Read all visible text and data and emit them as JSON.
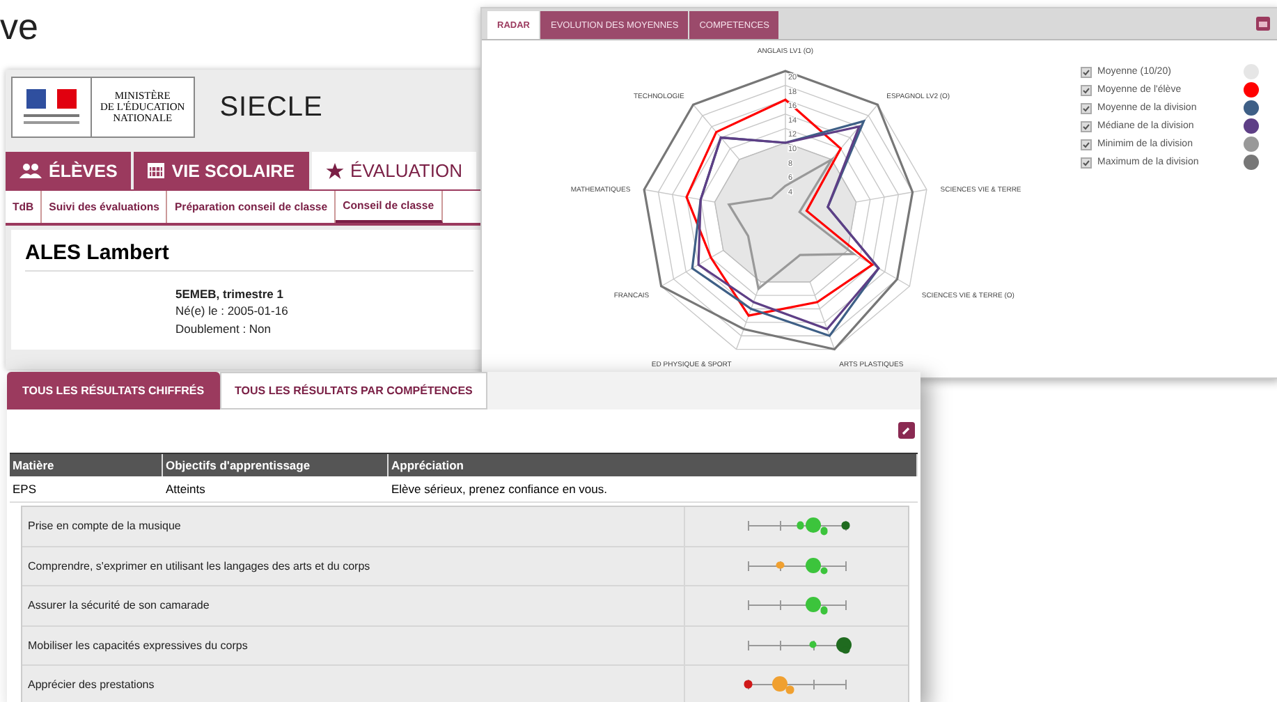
{
  "fragment": {
    "text": "ve"
  },
  "radar_window": {
    "tabs": [
      {
        "label": "RADAR",
        "selected": true
      },
      {
        "label": "EVOLUTION DES MOYENNES",
        "selected": false
      },
      {
        "label": "COMPETENCES",
        "selected": false
      }
    ],
    "axes": [
      "ANGLAIS LV1 (O)",
      "TECHNOLOGIE",
      "ESPAGNOL LV2 (O)",
      "MATHEMATIQUES",
      "SCIENCES VIE & TERRE",
      "FRANCAIS",
      "SCIENCES VIE & TERRE (O)",
      "ED PHYSIQUE & SPORT",
      "ARTS PLASTIQUES"
    ],
    "ticks": [
      "20",
      "18",
      "16",
      "14",
      "12",
      "10",
      "8",
      "6",
      "4"
    ],
    "legend": [
      {
        "label": "Moyenne (10/20)",
        "checked": true,
        "color": "#e6e6e6"
      },
      {
        "label": "Moyenne de l'élève",
        "checked": true,
        "color": "#ff0000"
      },
      {
        "label": "Moyenne de la division",
        "checked": true,
        "color": "#3e5f86"
      },
      {
        "label": "Médiane de la division",
        "checked": true,
        "color": "#5e3f86"
      },
      {
        "label": "Minimim de la division",
        "checked": true,
        "color": "#999999"
      },
      {
        "label": "Maximum de la division",
        "checked": true,
        "color": "#777777"
      }
    ]
  },
  "siecle": {
    "logo_lines": [
      "MINISTÈRE",
      "DE L'ÉDUCATION",
      "NATIONALE"
    ],
    "app_name": "SIECLE",
    "tabs": [
      {
        "label": "ÉLÈVES",
        "selected": false
      },
      {
        "label": "VIE SCOLAIRE",
        "selected": false
      },
      {
        "label": "ÉVALUATION",
        "selected": true
      }
    ],
    "subtabs": [
      {
        "label": "TdB",
        "selected": false
      },
      {
        "label": "Suivi des évaluations",
        "selected": false
      },
      {
        "label": "Préparation conseil de classe",
        "selected": false
      },
      {
        "label": "Conseil de classe",
        "selected": true
      }
    ],
    "student": {
      "name": "ALES Lambert",
      "class": "5EMEB, trimestre 1",
      "born": "Né(e) le : 2005-01-16",
      "repeat": "Doublement : Non"
    }
  },
  "results": {
    "tabs": [
      {
        "label": "TOUS LES RÉSULTATS CHIFFRÉS",
        "selected": true
      },
      {
        "label": "TOUS LES RÉSULTATS PAR COMPÉTENCES",
        "selected": false
      }
    ],
    "columns": [
      "Matière",
      "Objectifs d'apprentissage",
      "Appréciation"
    ],
    "rows": [
      {
        "cells": [
          "EPS",
          "Atteints",
          "Elève sérieux, prenez confiance en vous."
        ]
      }
    ],
    "competences": [
      {
        "label": "Prise en compte de la musique",
        "dots": [
          {
            "level": 0.54,
            "kind": "small",
            "color": "#3cc43c"
          },
          {
            "level": 0.67,
            "kind": "large",
            "color": "#3cc43c"
          },
          {
            "level": 0.78,
            "kind": "small",
            "color": "#3cc43c"
          },
          {
            "level": 1.0,
            "kind": "small",
            "color": "#1f6b1f"
          }
        ]
      },
      {
        "label": "Comprendre, s'exprimer en utilisant les langages des arts et du corps",
        "dots": [
          {
            "level": 0.33,
            "kind": "small",
            "color": "#f0a030"
          },
          {
            "level": 0.67,
            "kind": "large",
            "color": "#3cc43c"
          },
          {
            "level": 0.78,
            "kind": "small",
            "color": "#3cc43c"
          }
        ]
      },
      {
        "label": "Assurer la sécurité de son camarade",
        "dots": [
          {
            "level": 0.67,
            "kind": "large",
            "color": "#3cc43c"
          },
          {
            "level": 0.78,
            "kind": "small",
            "color": "#3cc43c"
          }
        ]
      },
      {
        "label": "Mobiliser les capacités expressives du corps",
        "dots": [
          {
            "level": 0.67,
            "kind": "small",
            "color": "#3cc43c"
          },
          {
            "level": 0.98,
            "kind": "large",
            "color": "#1f6b1f"
          },
          {
            "level": 1.0,
            "kind": "small",
            "color": "#1f6b1f"
          }
        ]
      },
      {
        "label": "Apprécier des prestations",
        "dots": [
          {
            "level": 0.0,
            "kind": "small",
            "color": "#d01818"
          },
          {
            "level": 0.33,
            "kind": "large",
            "color": "#f0a030"
          },
          {
            "level": 0.43,
            "kind": "small",
            "color": "#f0a030"
          }
        ]
      }
    ]
  }
}
